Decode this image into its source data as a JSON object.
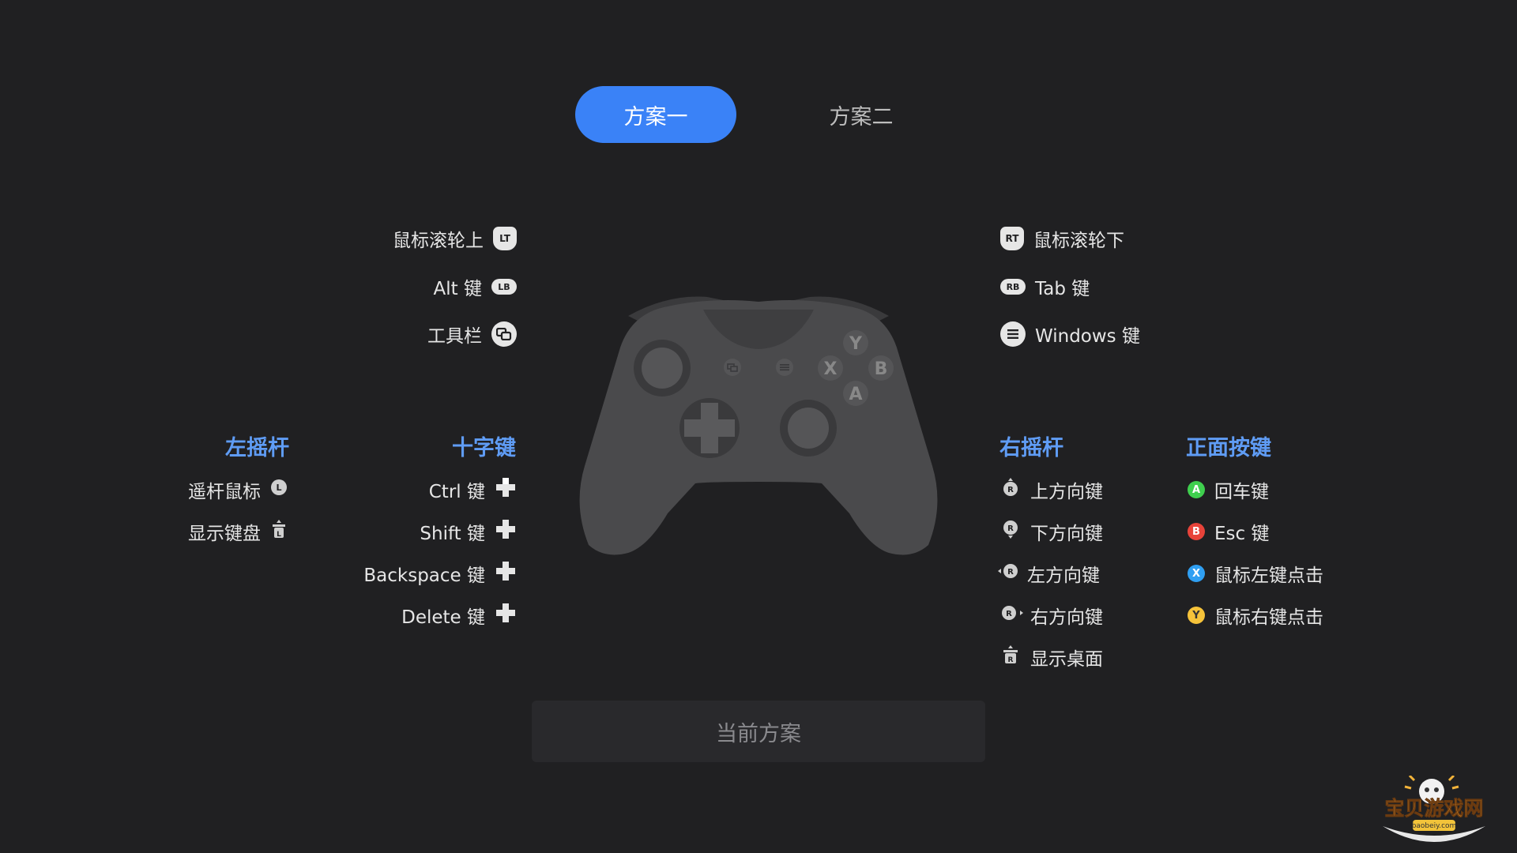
{
  "tabs": [
    {
      "label": "方案一",
      "active": true
    },
    {
      "label": "方案二",
      "active": false
    }
  ],
  "left_top": [
    {
      "label": "鼠标滚轮上",
      "icon": "lt-trigger-icon",
      "button": "LT"
    },
    {
      "label": "Alt 键",
      "icon": "lb-bumper-icon",
      "button": "LB"
    },
    {
      "label": "工具栏",
      "icon": "view-button-icon"
    }
  ],
  "right_top": [
    {
      "label": "鼠标滚轮下",
      "icon": "rt-trigger-icon",
      "button": "RT"
    },
    {
      "label": "Tab 键",
      "icon": "rb-bumper-icon",
      "button": "RB"
    },
    {
      "label": "Windows 键",
      "icon": "menu-button-icon"
    }
  ],
  "left_stick": {
    "heading": "左摇杆",
    "items": [
      {
        "label": "遥杆鼠标",
        "icon": "left-stick-move-icon"
      },
      {
        "label": "显示键盘",
        "icon": "left-stick-press-icon"
      }
    ]
  },
  "dpad": {
    "heading": "十字键",
    "items": [
      {
        "label": "Ctrl 键",
        "icon": "dpad-up-icon"
      },
      {
        "label": "Shift 键",
        "icon": "dpad-down-icon"
      },
      {
        "label": "Backspace 键",
        "icon": "dpad-left-icon"
      },
      {
        "label": "Delete 键",
        "icon": "dpad-right-icon"
      }
    ]
  },
  "right_stick": {
    "heading": "右摇杆",
    "items": [
      {
        "label": "上方向键",
        "icon": "right-stick-up-icon"
      },
      {
        "label": "下方向键",
        "icon": "right-stick-down-icon"
      },
      {
        "label": "左方向键",
        "icon": "right-stick-left-icon"
      },
      {
        "label": "右方向键",
        "icon": "right-stick-right-icon"
      },
      {
        "label": "显示桌面",
        "icon": "right-stick-press-icon"
      }
    ]
  },
  "face_buttons": {
    "heading": "正面按键",
    "items": [
      {
        "label": "回车键",
        "button": "A",
        "color": "#3fcf4e"
      },
      {
        "label": "Esc 键",
        "button": "B",
        "color": "#e8433a"
      },
      {
        "label": "鼠标左键点击",
        "button": "X",
        "color": "#2f9ff2"
      },
      {
        "label": "鼠标右键点击",
        "button": "Y",
        "color": "#f6c33a"
      }
    ]
  },
  "controller_labels": {
    "y": "Y",
    "x": "X",
    "b": "B",
    "a": "A"
  },
  "current_plan_label": "当前方案",
  "watermark": {
    "text": "宝贝游戏网",
    "sub": "baobeiy.com"
  },
  "colors": {
    "accent": "#3a82f7",
    "heading": "#5f9cf5",
    "background": "#202022"
  }
}
